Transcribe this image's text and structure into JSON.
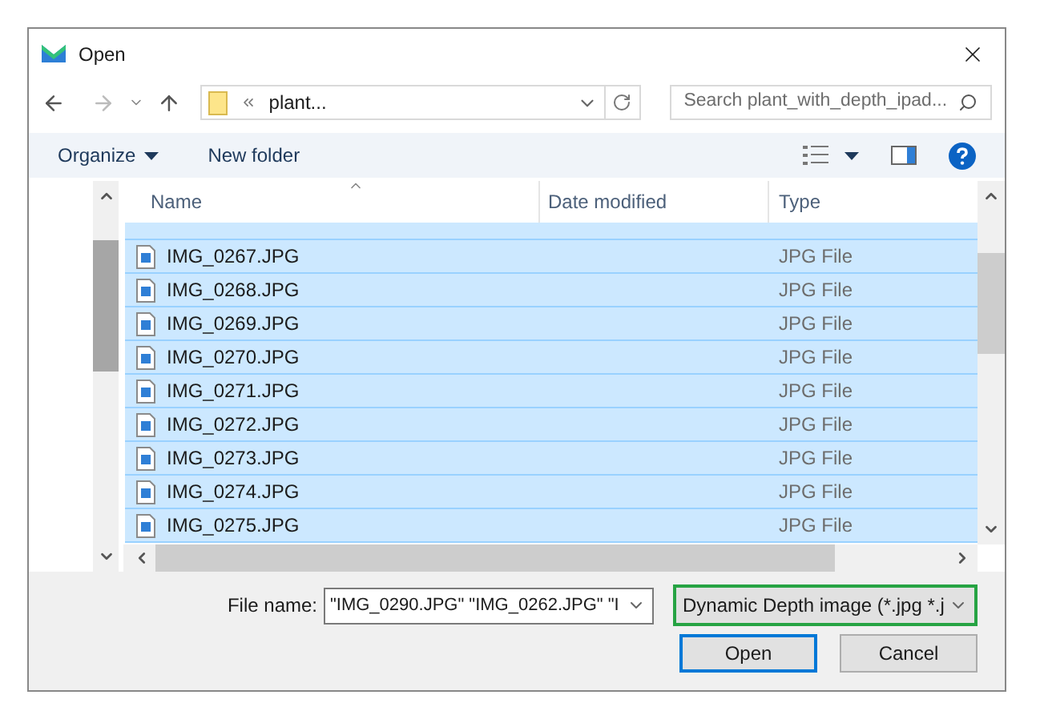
{
  "window": {
    "title": "Open"
  },
  "address": {
    "path": "plant...",
    "search_placeholder": "Search plant_with_depth_ipad..."
  },
  "toolbar": {
    "organize": "Organize",
    "new_folder": "New folder"
  },
  "columns": [
    "Name",
    "Date modified",
    "Type"
  ],
  "rows": [
    {
      "name": "IMG_0267.JPG",
      "type": "JPG File",
      "selected": true
    },
    {
      "name": "IMG_0268.JPG",
      "type": "JPG File",
      "selected": true
    },
    {
      "name": "IMG_0269.JPG",
      "type": "JPG File",
      "selected": true
    },
    {
      "name": "IMG_0270.JPG",
      "type": "JPG File",
      "selected": true
    },
    {
      "name": "IMG_0271.JPG",
      "type": "JPG File",
      "selected": true
    },
    {
      "name": "IMG_0272.JPG",
      "type": "JPG File",
      "selected": true
    },
    {
      "name": "IMG_0273.JPG",
      "type": "JPG File",
      "selected": true
    },
    {
      "name": "IMG_0274.JPG",
      "type": "JPG File",
      "selected": true
    },
    {
      "name": "IMG_0275.JPG",
      "type": "JPG File",
      "selected": true
    }
  ],
  "file_name": {
    "label": "File name:",
    "value": "\"IMG_0290.JPG\" \"IMG_0262.JPG\" \"I"
  },
  "file_type": {
    "value": "Dynamic Depth image (*.jpg *.j",
    "focused": true
  },
  "buttons": [
    {
      "label": "Open",
      "default": true
    },
    {
      "label": "Cancel",
      "default": false
    }
  ]
}
